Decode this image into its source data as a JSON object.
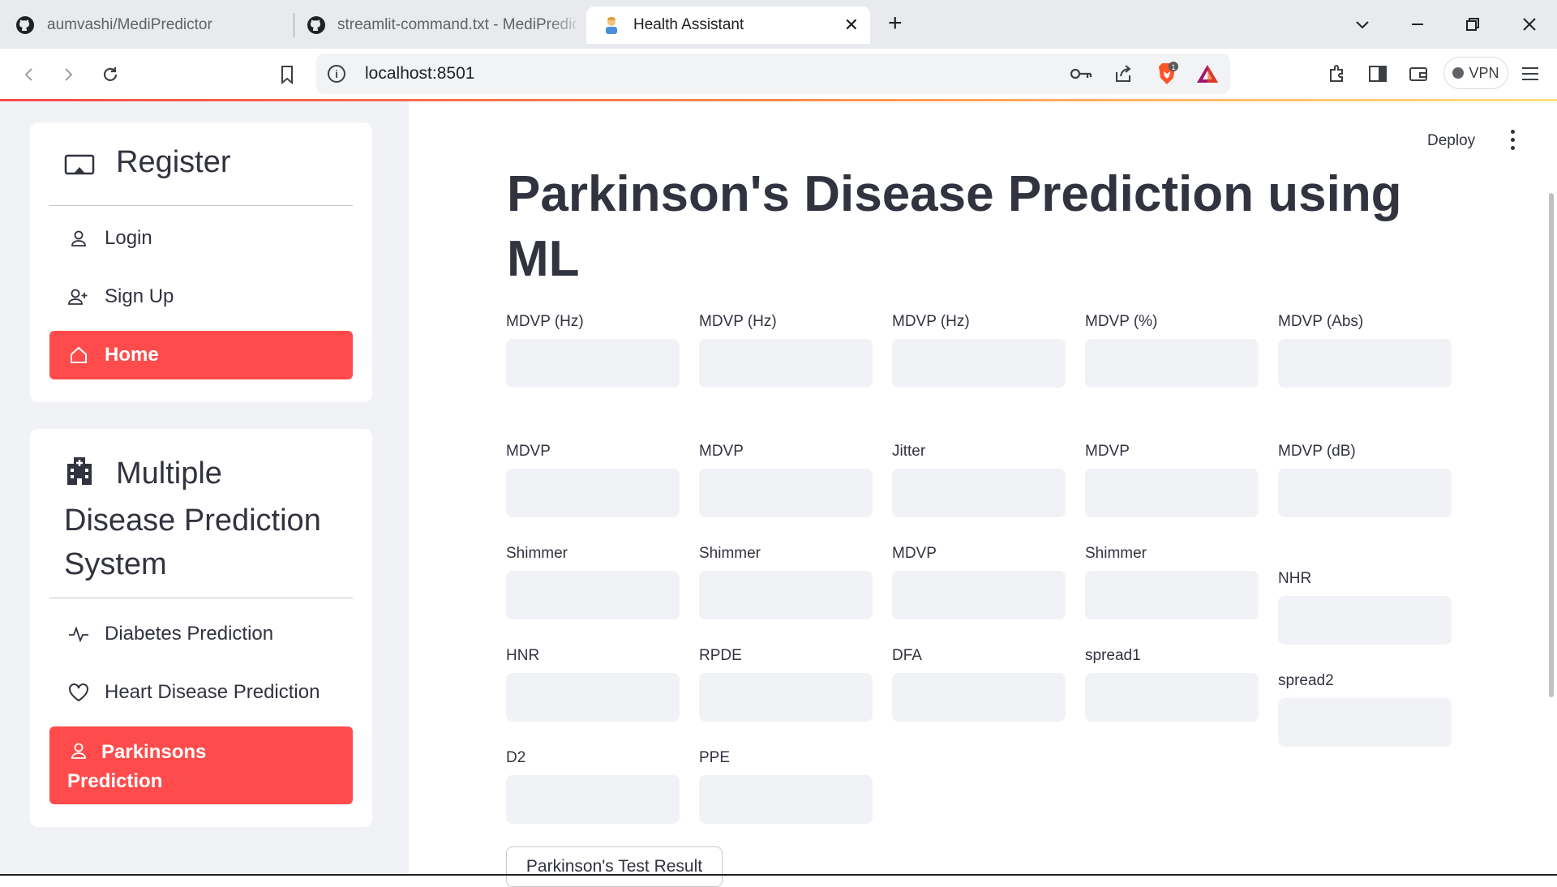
{
  "browser": {
    "tabs": [
      {
        "title": "aumvashi/MediPredictor",
        "icon": "github-icon"
      },
      {
        "title": "streamlit-command.txt - MediPredict",
        "icon": "github-icon"
      },
      {
        "title": "Health Assistant",
        "icon": "streamlit-favicon-icon",
        "active": true
      }
    ],
    "url": "localhost:8501",
    "vpn_label": "VPN",
    "brave_badge": "1"
  },
  "sidebar": {
    "auth_menu": {
      "title": "Register",
      "icon": "cast-icon",
      "items": [
        {
          "label": "Login",
          "icon": "person-icon",
          "active": false
        },
        {
          "label": "Sign Up",
          "icon": "person-add-icon",
          "active": false
        },
        {
          "label": "Home",
          "icon": "house-icon",
          "active": true
        }
      ]
    },
    "prediction_menu": {
      "title": "Multiple Disease Prediction System",
      "icon": "hospital-icon",
      "items": [
        {
          "label": "Diabetes Prediction",
          "icon": "activity-icon",
          "active": false
        },
        {
          "label": "Heart Disease Prediction",
          "icon": "heart-icon",
          "active": false
        },
        {
          "label": "Parkinsons Prediction",
          "icon": "person-icon",
          "active": true
        }
      ]
    }
  },
  "header": {
    "deploy_label": "Deploy"
  },
  "main": {
    "title": "Parkinson's Disease Prediction using ML",
    "fields": [
      {
        "label": "MDVP (Hz)",
        "value": ""
      },
      {
        "label": "MDVP (Hz)",
        "value": ""
      },
      {
        "label": "MDVP (Hz)",
        "value": ""
      },
      {
        "label": "MDVP (%)",
        "value": ""
      },
      {
        "label": "MDVP (Abs)",
        "value": ""
      },
      {
        "label": "MDVP",
        "value": ""
      },
      {
        "label": "MDVP",
        "value": ""
      },
      {
        "label": "Jitter",
        "value": ""
      },
      {
        "label": "MDVP",
        "value": ""
      },
      {
        "label": "MDVP (dB)",
        "value": ""
      },
      {
        "label": "Shimmer",
        "value": ""
      },
      {
        "label": "Shimmer",
        "value": ""
      },
      {
        "label": "MDVP",
        "value": ""
      },
      {
        "label": "Shimmer",
        "value": ""
      },
      {
        "label": "NHR",
        "value": ""
      },
      {
        "label": "HNR",
        "value": ""
      },
      {
        "label": "RPDE",
        "value": ""
      },
      {
        "label": "DFA",
        "value": ""
      },
      {
        "label": "spread1",
        "value": ""
      },
      {
        "label": "spread2",
        "value": ""
      },
      {
        "label": "D2",
        "value": ""
      },
      {
        "label": "PPE",
        "value": ""
      }
    ],
    "submit_label": "Parkinson's Test Result"
  },
  "colors": {
    "primary": "#ff4b4b",
    "sidebar_bg": "#f0f2f6",
    "text": "#31333f"
  }
}
